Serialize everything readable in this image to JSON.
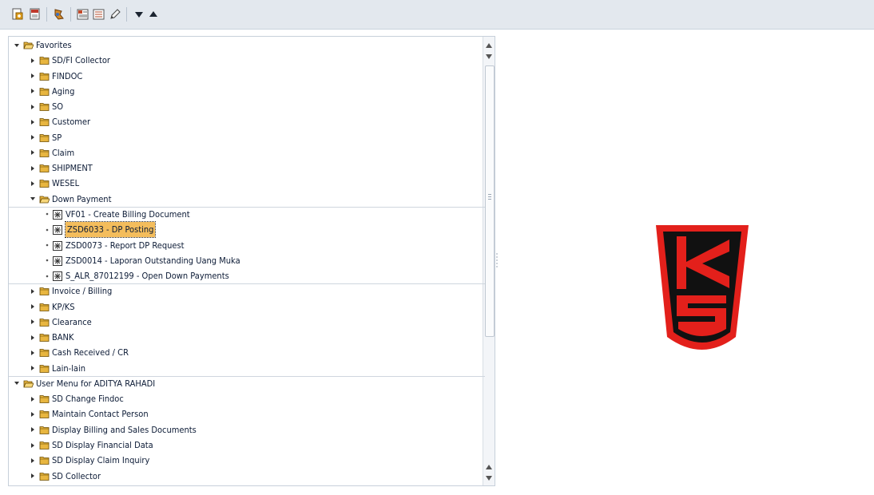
{
  "toolbar": {
    "buttons": [
      {
        "name": "add-favorite-icon",
        "color": "#d8a21c"
      },
      {
        "name": "add-other-object-icon",
        "color": "#c0392b"
      },
      {
        "name": "sap-menu-icon",
        "color": "#d18a2a"
      },
      {
        "name": "user-menu-icon",
        "color": "#c44a2a"
      },
      {
        "name": "display-list-icon",
        "color": "#b04a2a"
      },
      {
        "name": "change-favorite-icon",
        "color": "#444444"
      },
      {
        "name": "move-down-icon",
        "color": "#1b2430"
      },
      {
        "name": "move-up-icon",
        "color": "#1b2430"
      }
    ]
  },
  "tree": {
    "favorites_root": "Favorites",
    "favorites_folders_top": [
      "SD/FI Collector",
      "FINDOC",
      "Aging",
      "SO",
      "Customer",
      "SP",
      "Claim",
      "SHIPMENT",
      "WESEL"
    ],
    "down_payment_folder": "Down Payment",
    "down_payment_items": [
      "VF01 - Create Billing Document",
      "ZSD6033 - DP Posting",
      "ZSD0073 - Report DP Request",
      "ZSD0014 - Laporan Outstanding Uang Muka",
      "S_ALR_87012199 - Open Down Payments"
    ],
    "selected_item": "ZSD6033 - DP Posting",
    "favorites_folders_bottom": [
      "Invoice / Billing",
      "KP/KS",
      "Clearance",
      "BANK",
      "Cash Received / CR",
      "Lain-lain"
    ],
    "user_menu_root": "User Menu for ADITYA RAHADI",
    "user_menu_folders": [
      "SD Change Findoc",
      "Maintain Contact Person",
      "Display Billing and Sales Documents",
      "SD Display Financial Data",
      "SD Display Claim Inquiry",
      "SD Collector"
    ]
  },
  "colors": {
    "folder": "#e8b640",
    "selection": "#f4bd5c",
    "logo_red": "#e3201b",
    "logo_black": "#111111"
  }
}
